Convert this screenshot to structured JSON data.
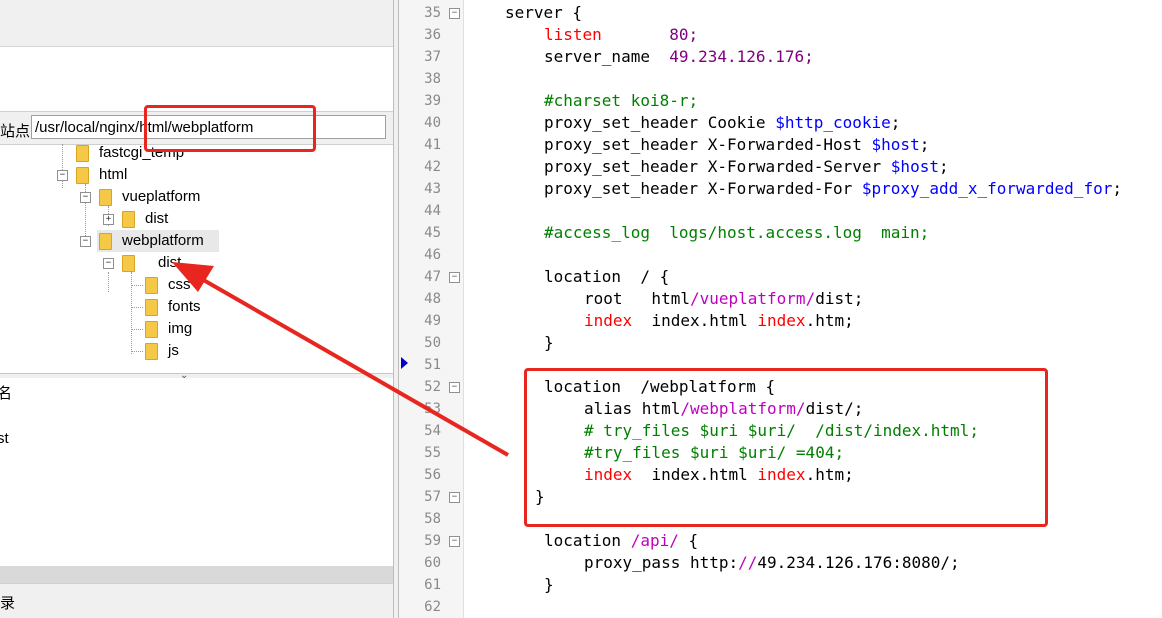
{
  "site": {
    "label": "站点:",
    "path_value": "/usr/local/nginx/html/webplatform"
  },
  "tree": {
    "items": [
      {
        "label": "fastcgi_temp"
      },
      {
        "label": "html"
      },
      {
        "label": "vueplatform"
      },
      {
        "label": "dist"
      },
      {
        "label": "webplatform"
      },
      {
        "label": "dist"
      },
      {
        "label": "css"
      },
      {
        "label": "fonts"
      },
      {
        "label": "img"
      },
      {
        "label": "js"
      }
    ]
  },
  "lower": {
    "header_fragment": "名",
    "row_fragment": "st"
  },
  "status": {
    "fragment": "录"
  },
  "code": {
    "lines": [
      {
        "n": "35",
        "text": "server {"
      },
      {
        "n": "36",
        "kw": "listen",
        "val": "80;"
      },
      {
        "n": "37",
        "a": "server_name",
        "b": "49.234.126.176;"
      },
      {
        "n": "38"
      },
      {
        "n": "39",
        "cmt": "#charset koi8-r;"
      },
      {
        "n": "40",
        "a": "proxy_set_header Cookie",
        "v": "$http_cookie",
        "e": ";"
      },
      {
        "n": "41",
        "a": "proxy_set_header X-Forwarded-Host",
        "v": "$host",
        "e": ";"
      },
      {
        "n": "42",
        "a": "proxy_set_header X-Forwarded-Server",
        "v": "$host",
        "e": ";"
      },
      {
        "n": "43",
        "a": "proxy_set_header X-Forwarded-For",
        "v": "$proxy_add_x_forwarded_for",
        "e": ";"
      },
      {
        "n": "44"
      },
      {
        "n": "45",
        "cmt": "#access_log  logs/host.access.log  main;"
      },
      {
        "n": "46"
      },
      {
        "n": "47",
        "text": "location  / {"
      },
      {
        "n": "48",
        "a": "root   html",
        "p": "/vueplatform/",
        "e": "dist;"
      },
      {
        "n": "49",
        "kw1": "index",
        "mid": "  index.html",
        "kw2": " index",
        "end": ".htm;"
      },
      {
        "n": "50",
        "text": "}"
      },
      {
        "n": "51"
      },
      {
        "n": "52",
        "text": "location  /webplatform {"
      },
      {
        "n": "53",
        "a": "alias html",
        "p": "/webplatform/",
        "e": "dist/;"
      },
      {
        "n": "54",
        "cmt": "# try_files $uri $uri/  /dist/index.html;"
      },
      {
        "n": "55",
        "cmt": "#try_files $uri $uri/ =404;"
      },
      {
        "n": "56",
        "kw1": "index",
        "mid": "  index.html",
        "kw2": " index",
        "end": ".htm;"
      },
      {
        "n": "57",
        "text": "}"
      },
      {
        "n": "58"
      },
      {
        "n": "59",
        "a": "location ",
        "p": "/api/",
        "e": " {"
      },
      {
        "n": "60",
        "a": "proxy_pass http:",
        "p": "//",
        "e": "49.234.126.176:8080/;"
      },
      {
        "n": "61",
        "text": "}"
      },
      {
        "n": "62"
      }
    ]
  },
  "colors": {
    "annotation_red": "#e8261f",
    "comment_green": "#008000",
    "variable_blue": "#0000ff",
    "directive_red": "#ff0000",
    "path_magenta": "#c000c0"
  }
}
